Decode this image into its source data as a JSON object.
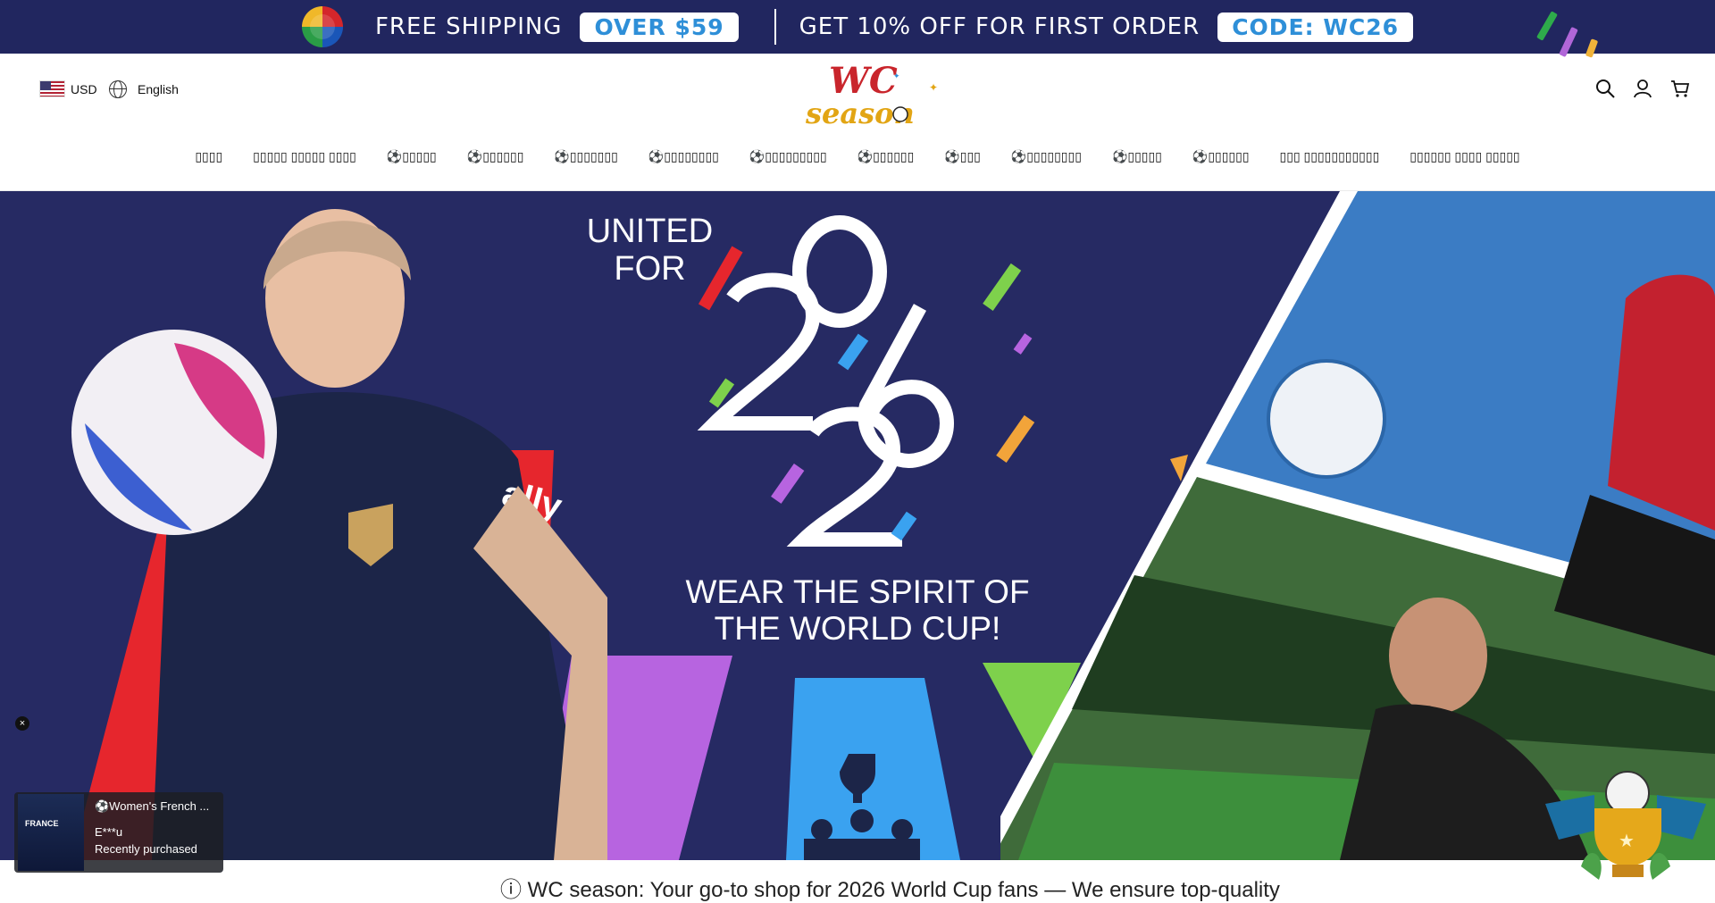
{
  "announcement": {
    "shipping_text": "FREE SHIPPING",
    "shipping_pill": "OVER $59",
    "discount_text": "GET 10% OFF FOR FIRST ORDER",
    "discount_pill": "CODE: WC26"
  },
  "header": {
    "currency": "USD",
    "language": "English",
    "logo_line1": "WC",
    "logo_line2": "season"
  },
  "nav": {
    "items": [
      "▯▯▯▯",
      "▯▯▯▯▯ ▯▯▯▯▯ ▯▯▯▯",
      "⚽▯▯▯▯▯",
      "⚽▯▯▯▯▯▯",
      "⚽▯▯▯▯▯▯▯",
      "⚽▯▯▯▯▯▯▯▯",
      "⚽▯▯▯▯▯▯▯▯▯",
      "⚽▯▯▯▯▯▯",
      "⚽▯▯▯",
      "⚽▯▯▯▯▯▯▯▯",
      "⚽▯▯▯▯▯",
      "⚽▯▯▯▯▯▯",
      "▯▯▯ ▯▯▯▯▯▯▯▯▯▯▯",
      "▯▯▯▯▯▯ ▯▯▯▯ ▯▯▯▯▯"
    ]
  },
  "hero": {
    "united_line1": "UNITED",
    "united_line2": "FOR",
    "year": "2026",
    "tagline_line1": "WEAR THE SPIRIT OF",
    "tagline_line2": "THE WORLD CUP!",
    "jersey_sponsor": "ally"
  },
  "popup": {
    "product": "⚽Women's French ...",
    "buyer": "E***u",
    "status": "Recently purchased",
    "image_text": "FRANCE",
    "close": "×"
  },
  "bottom_bar": {
    "text": "ⓘ WC season: Your go-to shop for 2026 World Cup fans — We ensure top-quality"
  },
  "colors": {
    "topbar_bg": "#21265f",
    "hero_bg": "#262a63",
    "pill_text": "#2e8fd8"
  },
  "icons": [
    "search-icon",
    "account-icon",
    "cart-icon",
    "globe-icon",
    "us-flag-icon",
    "close-icon",
    "soccer-ball-icon",
    "trophy-icon"
  ]
}
